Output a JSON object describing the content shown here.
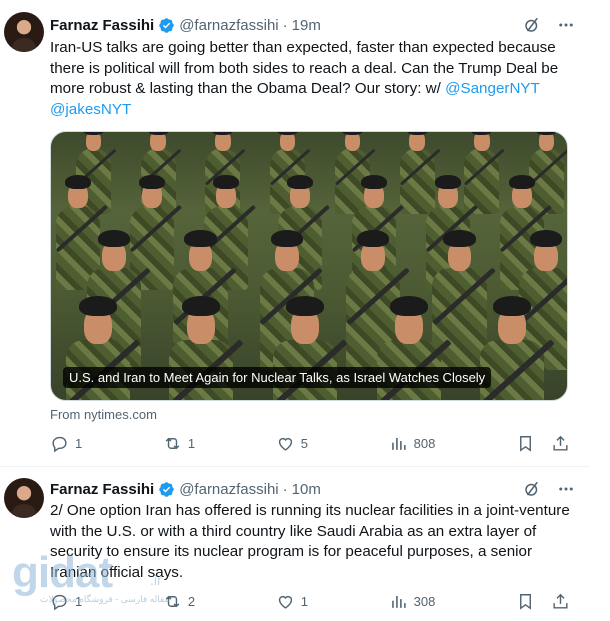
{
  "tweets": [
    {
      "name": "Farnaz Fassihi",
      "handle": "@farnazfassihi",
      "dot": "·",
      "time": "19m",
      "text_plain": "Iran-US talks are going better than expected, faster than expected because there is political will from both sides to reach a deal. Can the Trump Deal be more robust & lasting than the Obama Deal? Our story: w/ ",
      "mention1": "@SangerNYT",
      "mention2": "@jakesNYT",
      "media_caption": "U.S. and Iran to Meet Again for Nuclear Talks, as Israel Watches Closely",
      "source": "From nytimes.com",
      "replies": "1",
      "retweets": "1",
      "likes": "5",
      "views": "808"
    },
    {
      "name": "Farnaz Fassihi",
      "handle": "@farnazfassihi",
      "dot": "·",
      "time": "10m",
      "text": "2/ One option Iran has offered is running its nuclear facilities in a joint-venture with the U.S. or with a third country like Saudi Arabia as an extra layer of security to ensure its nuclear program is for peaceful purposes, a senior Iranian official says.",
      "replies": "1",
      "retweets": "2",
      "likes": "1",
      "views": "308"
    }
  ],
  "watermark": {
    "logo": "gidat",
    "suffix": ".ir",
    "subtitle": "مقاله فارسی - فروشگاه محصولات"
  },
  "colors": {
    "accent": "#1d9bf0",
    "secondary_text": "#536471",
    "primary_text": "#0f1419"
  },
  "icons": [
    "verified-badge-icon",
    "grok-icon",
    "more-icon",
    "reply-icon",
    "retweet-icon",
    "like-icon",
    "views-icon",
    "bookmark-icon",
    "share-icon"
  ]
}
